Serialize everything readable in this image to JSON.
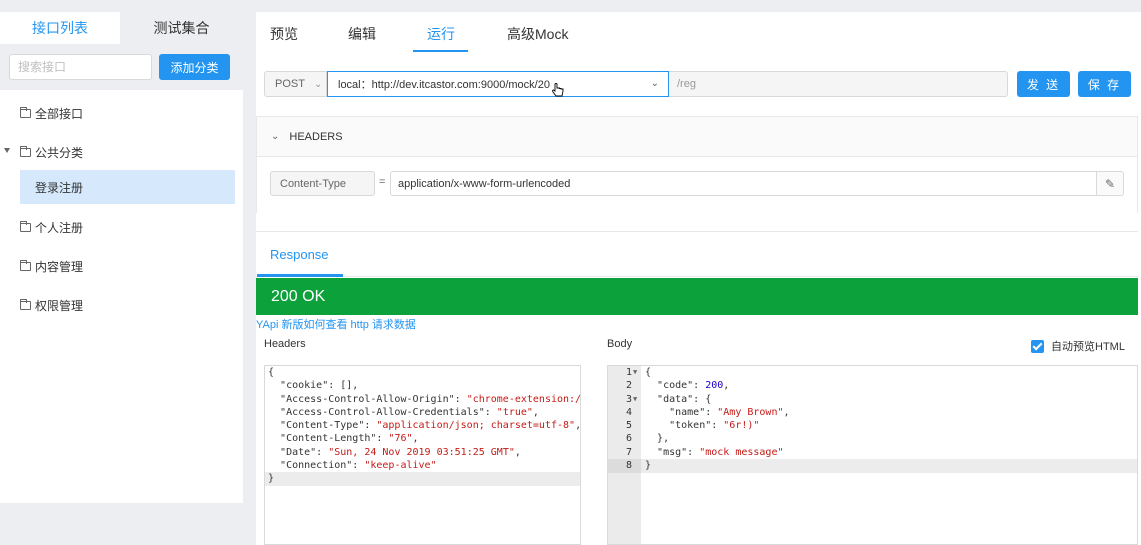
{
  "sidebar": {
    "tabs": [
      {
        "label": "接口列表",
        "active": true
      },
      {
        "label": "测试集合",
        "active": false
      }
    ],
    "search_placeholder": "搜索接口",
    "add_category_label": "添加分类",
    "tree": {
      "all": "全部接口",
      "public": "公共分类",
      "public_child": "登录注册",
      "personal": "个人注册",
      "content": "内容管理",
      "permission": "权限管理"
    }
  },
  "main": {
    "tabs": {
      "preview": "预览",
      "edit": "编辑",
      "run": "运行",
      "mock": "高级Mock"
    },
    "active_tab": "运行",
    "request": {
      "method": "POST",
      "base_url": "local：http://dev.itcastor.com:9000/mock/20",
      "path": "/reg",
      "send_label": "发 送",
      "save_label": "保 存"
    },
    "headers_section": {
      "title": "HEADERS",
      "key": "Content-Type",
      "eq": "=",
      "value": "application/x-www-form-urlencoded"
    },
    "response": {
      "tab_label": "Response",
      "status": "200 OK",
      "status_color": "#0ca13b",
      "help_link": "YApi 新版如何查看 http 请求数据",
      "headers_label": "Headers",
      "body_label": "Body",
      "auto_preview_label": "自动预览HTML",
      "auto_preview_checked": true
    }
  },
  "colors": {
    "accent": "#2395f1",
    "selected_bg": "#d5e8fc"
  }
}
